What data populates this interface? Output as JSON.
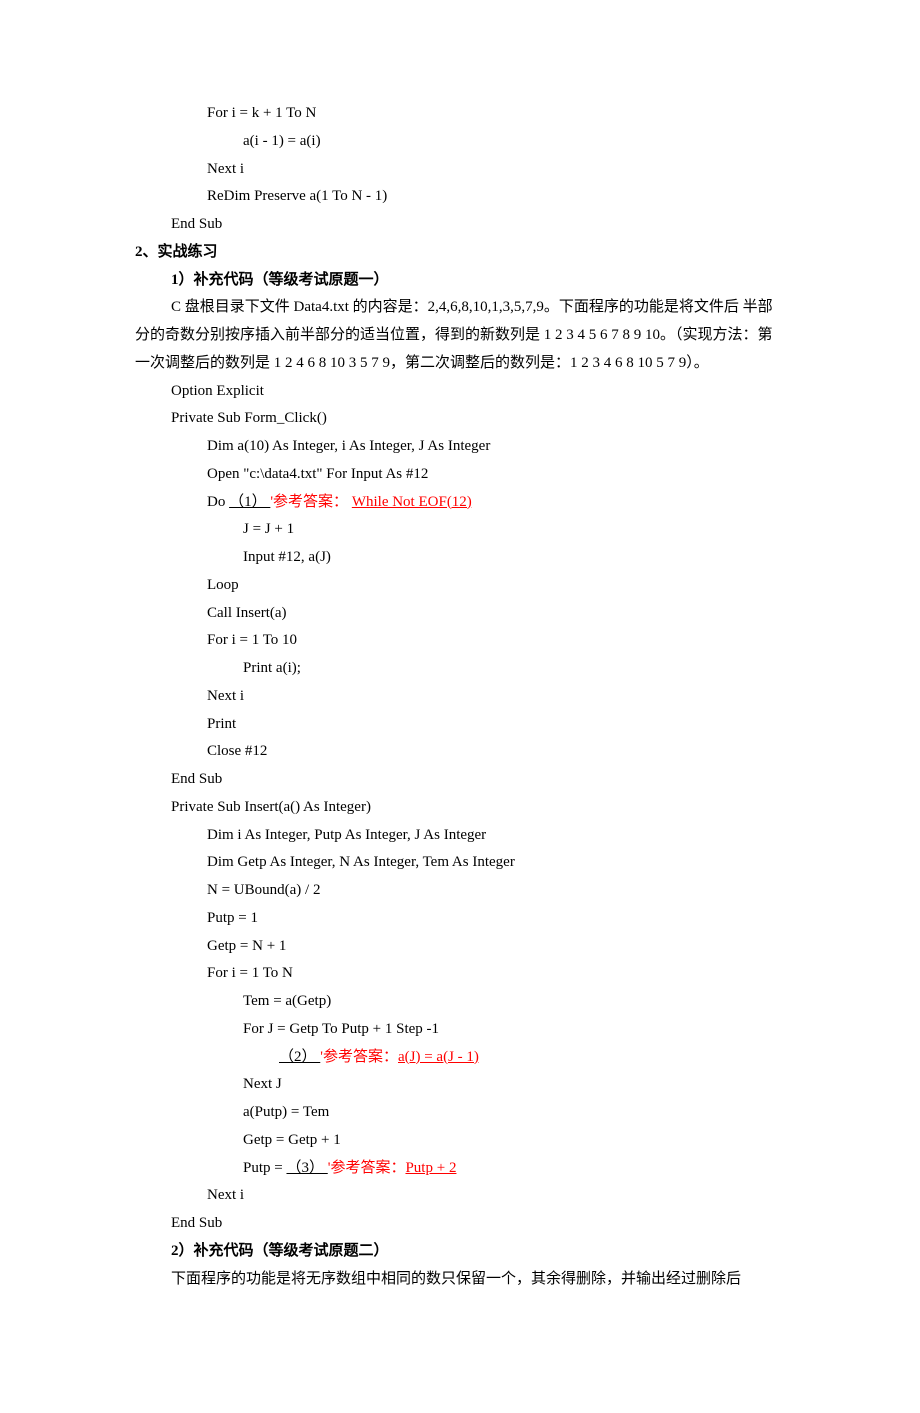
{
  "topcode": {
    "l1": "For i = k + 1 To N",
    "l2": "a(i - 1) = a(i)",
    "l3": "Next i",
    "l4": "ReDim Preserve a(1 To N - 1)",
    "l5": "End Sub"
  },
  "h2a": "2、实战练习",
  "h3a": "1）补充代码（等级考试原题一）",
  "p1a": "C 盘根目录下文件 Data4.txt 的内容是：2,4,6,8,10,1,3,5,7,9。下面程序的功能是将文件后",
  "p1b": "半部分的奇数分别按序插入前半部分的适当位置，得到的新数列是 1 2 3 4 5 6 7 8 9 10。（实现方法：第一次调整后的数列是 1 2 4 6 8 10 3 5 7 9，第二次调整后的数列是：1 2 3 4 6 8 10 5 7 9）。",
  "c1": {
    "l1": "Option Explicit",
    "l2": "Private Sub Form_Click()",
    "l3": "Dim a(10) As Integer, i As Integer, J As Integer",
    "l4": "Open \"c:\\data4.txt\" For Input As #12",
    "l5a": "Do   ",
    "l5b": "       （1）       ",
    "l5c": "  '参考答案：   ",
    "l5d": "While Not EOF(12)",
    "l6": "J = J + 1",
    "l7": "Input #12, a(J)",
    "l8": "Loop",
    "l9": "Call Insert(a)",
    "l10": "For i = 1 To 10",
    "l11": "Print a(i);",
    "l12": "Next i",
    "l13": "Print",
    "l14": "Close #12",
    "l15": "End Sub",
    "l16": "Private Sub Insert(a() As Integer)",
    "l17": "Dim i As Integer, Putp As Integer, J As Integer",
    "l18": "Dim Getp As Integer, N As Integer, Tem As Integer",
    "l19": "N = UBound(a) / 2",
    "l20": "Putp = 1",
    "l21": "Getp = N + 1",
    "l22": "For i = 1 To N",
    "l23": "Tem = a(Getp)",
    "l24": "For J = Getp To Putp + 1 Step -1",
    "l25b": "      （2）      ",
    "l25c": "  '参考答案：",
    "l25d": "a(J) = a(J - 1)",
    "l26": "Next J",
    "l27": "a(Putp) = Tem",
    "l28": "Getp = Getp + 1",
    "l29a": "Putp = ",
    "l29b": "       （3）         ",
    "l29c": "   '参考答案：",
    "l29d": "Putp + 2",
    "l30": "Next i",
    "l31": "End Sub"
  },
  "h3b": "2）补充代码（等级考试原题二）",
  "p2": "下面程序的功能是将无序数组中相同的数只保留一个，其余得删除，并输出经过删除后"
}
